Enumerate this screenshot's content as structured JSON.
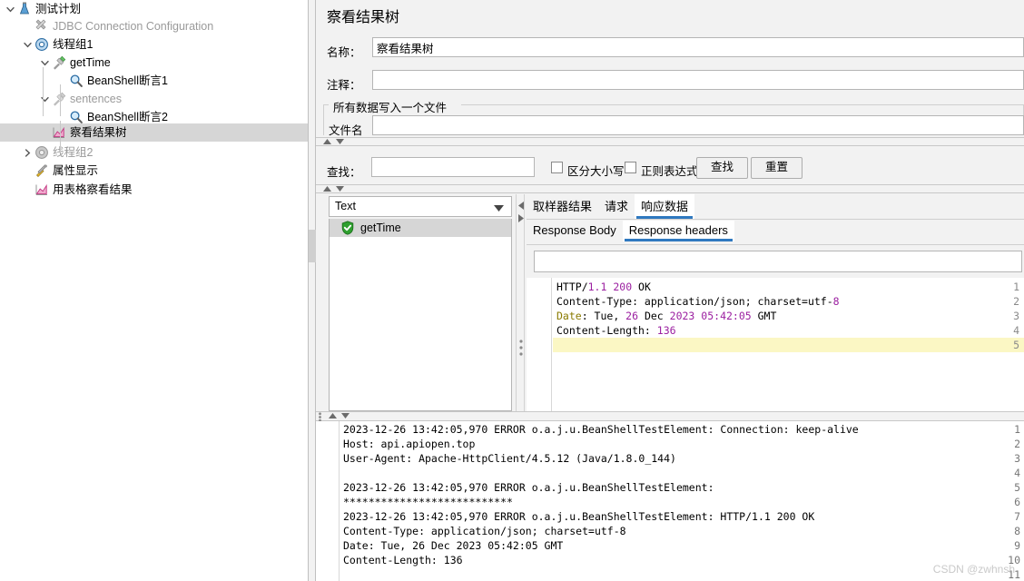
{
  "tree": {
    "items": [
      {
        "label": "测试计划",
        "icon": "flask-icon",
        "indent": 0,
        "toggle": "expanded",
        "dim": false,
        "selected": false
      },
      {
        "label": "JDBC Connection Configuration",
        "icon": "tools-icon",
        "indent": 1,
        "toggle": "none",
        "dim": true,
        "selected": false
      },
      {
        "label": "线程组1",
        "icon": "gear-blue-icon",
        "indent": 1,
        "toggle": "expanded",
        "dim": false,
        "selected": false
      },
      {
        "label": "getTime",
        "icon": "pipette-green-icon",
        "indent": 2,
        "toggle": "expanded",
        "dim": false,
        "selected": false
      },
      {
        "label": "BeanShell断言1",
        "icon": "magnifier-icon",
        "indent": 3,
        "toggle": "none",
        "dim": false,
        "selected": false
      },
      {
        "label": "sentences",
        "icon": "pipette-gray-icon",
        "indent": 2,
        "toggle": "expanded",
        "dim": true,
        "selected": false
      },
      {
        "label": "BeanShell断言2",
        "icon": "magnifier-icon",
        "indent": 3,
        "toggle": "none",
        "dim": false,
        "selected": false
      },
      {
        "label": "察看结果树",
        "icon": "chart-pink-icon",
        "indent": 2,
        "toggle": "none",
        "dim": false,
        "selected": true
      },
      {
        "label": "线程组2",
        "icon": "gear-gray-icon",
        "indent": 1,
        "toggle": "collapsed",
        "dim": true,
        "selected": false
      },
      {
        "label": "属性显示",
        "icon": "tools-color-icon",
        "indent": 1,
        "toggle": "none",
        "dim": false,
        "selected": false
      },
      {
        "label": "用表格察看结果",
        "icon": "chart-pink-icon",
        "indent": 1,
        "toggle": "none",
        "dim": false,
        "selected": false
      }
    ]
  },
  "config": {
    "panel_title": "察看结果树",
    "name_label": "名称：",
    "name_value": "察看结果树",
    "comment_label": "注释：",
    "comment_value": "",
    "group_title": "所有数据写入一个文件",
    "filename_label": "文件名",
    "filename_value": ""
  },
  "search": {
    "label": "查找：",
    "value": "",
    "case_sensitive_label": "区分大小写",
    "regex_label": "正则表达式",
    "search_button": "查找",
    "reset_button": "重置"
  },
  "results": {
    "renderer_selected": "Text",
    "items": [
      {
        "label": "getTime",
        "status": "success",
        "selected": true
      }
    ],
    "tabs": [
      {
        "label": "取样器结果",
        "active": false
      },
      {
        "label": "请求",
        "active": false
      },
      {
        "label": "响应数据",
        "active": true
      }
    ],
    "subtabs": [
      {
        "label": "Response Body",
        "active": false
      },
      {
        "label": "Response headers",
        "active": true
      }
    ],
    "response_search_value": "",
    "code_lines": [
      {
        "n": "1",
        "segments": [
          {
            "t": "HTTP/",
            "c": "plain"
          },
          {
            "t": "1.1",
            "c": "num"
          },
          {
            "t": " ",
            "c": "plain"
          },
          {
            "t": "200",
            "c": "num"
          },
          {
            "t": " OK",
            "c": "plain"
          }
        ],
        "highlight": false
      },
      {
        "n": "2",
        "segments": [
          {
            "t": "Content-Type: application/json; charset=utf-",
            "c": "plain"
          },
          {
            "t": "8",
            "c": "num"
          }
        ],
        "highlight": false
      },
      {
        "n": "3",
        "segments": [
          {
            "t": "Date",
            "c": "key"
          },
          {
            "t": ": Tue, ",
            "c": "plain"
          },
          {
            "t": "26",
            "c": "num"
          },
          {
            "t": " Dec ",
            "c": "plain"
          },
          {
            "t": "2023",
            "c": "num"
          },
          {
            "t": " ",
            "c": "plain"
          },
          {
            "t": "05:42:05",
            "c": "num"
          },
          {
            "t": " GMT",
            "c": "plain"
          }
        ],
        "highlight": false
      },
      {
        "n": "4",
        "segments": [
          {
            "t": "Content-Length: ",
            "c": "plain"
          },
          {
            "t": "136",
            "c": "num"
          }
        ],
        "highlight": false
      },
      {
        "n": "5",
        "segments": [
          {
            "t": "",
            "c": "plain"
          }
        ],
        "highlight": true
      }
    ]
  },
  "log": {
    "lines": [
      {
        "n": "1",
        "text": "2023-12-26 13:42:05,970 ERROR o.a.j.u.BeanShellTestElement: Connection: keep-alive"
      },
      {
        "n": "2",
        "text": "Host: api.apiopen.top"
      },
      {
        "n": "3",
        "text": "User-Agent: Apache-HttpClient/4.5.12 (Java/1.8.0_144)"
      },
      {
        "n": "4",
        "text": ""
      },
      {
        "n": "5",
        "text": "2023-12-26 13:42:05,970 ERROR o.a.j.u.BeanShellTestElement:"
      },
      {
        "n": "6",
        "text": "***************************"
      },
      {
        "n": "7",
        "text": "2023-12-26 13:42:05,970 ERROR o.a.j.u.BeanShellTestElement: HTTP/1.1 200 OK"
      },
      {
        "n": "8",
        "text": "Content-Type: application/json; charset=utf-8"
      },
      {
        "n": "9",
        "text": "Date: Tue, 26 Dec 2023 05:42:05 GMT"
      },
      {
        "n": "10",
        "text": "Content-Length: 136"
      },
      {
        "n": "11",
        "text": ""
      }
    ]
  },
  "watermark": {
    "text": "CSDN @zwhnsh"
  },
  "colors": {
    "selection": "#d6d6d6",
    "accent": "#2f79c0",
    "panel_bg": "#f2f2f2",
    "number_token": "#9b1fa0",
    "key_token": "#8a7a00",
    "highlight_line": "#fbf7c4"
  }
}
